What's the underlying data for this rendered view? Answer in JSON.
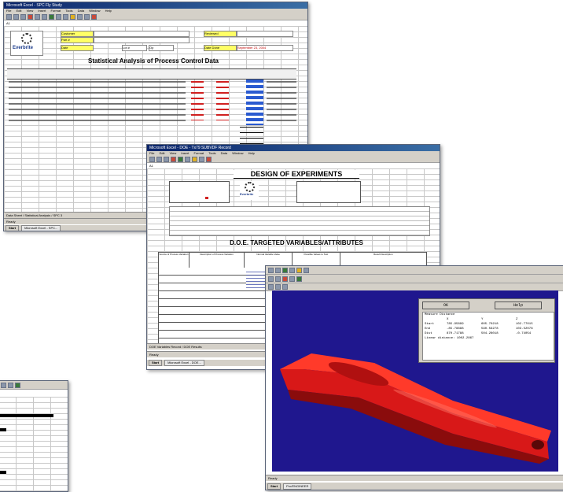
{
  "win1": {
    "title": "Microsoft Excel - SPC Fly Study",
    "menu": [
      "File",
      "Edit",
      "View",
      "Insert",
      "Format",
      "Tools",
      "Data",
      "Window",
      "Help"
    ],
    "cell_ref": "A1",
    "company": "Everbrite",
    "report_title": "Statistical Analysis of Process Control Data",
    "field_labels": [
      "Customer",
      "Part #",
      "Date",
      "Lot #",
      "Op",
      "Reviewed",
      "Date Done"
    ],
    "date_value": "September 23, 2004",
    "sheet_tabs": "Data Sheet / Statistical Analysis / SPC 3",
    "status": "Ready",
    "taskbar_start": "Start",
    "taskbar_item": "Microsoft Excel - SPC..."
  },
  "win2": {
    "title": "Microsoft Excel - DOE - Tx79 SUBVDF Record",
    "menu": [
      "File",
      "Edit",
      "View",
      "Insert",
      "Format",
      "Tools",
      "Data",
      "Window",
      "Help"
    ],
    "cell_ref": "A1",
    "heading": "DESIGN OF EXPERIMENTS",
    "subheading": "D.O.E. TARGETED VARIABLES/ATTRIBUTES",
    "company": "Everbrite",
    "col_headers": [
      "Source of Process Variation",
      "Description of Process Variation",
      "Normal Variable Value",
      "Possible Values to Test",
      "Result Description"
    ],
    "sheet_tabs": "DOE Variables Record / DOE Results",
    "status": "Ready",
    "taskbar_start": "Start",
    "taskbar_item": "Microsoft Excel - DOE..."
  },
  "win3": {
    "dialog": {
      "ok": "OK",
      "help": "Help",
      "heading": "Measure Distance",
      "col_x": "X",
      "col_y": "Y",
      "col_z": "Z",
      "rows": [
        [
          "Start",
          "785.95899",
          "605.70218",
          "102.77015"
        ],
        [
          "End",
          "-85.78888",
          "590.56278",
          "103.52078"
        ],
        [
          "Dist",
          "870.71788",
          "504.28018",
          "-0.74054"
        ]
      ],
      "linear": "Linear distance: 1002.2867"
    },
    "status": "Ready",
    "taskbar_start": "Start",
    "taskbar_item": "Pro/ENGINEER"
  },
  "colors": {
    "excel_title": "#0a246a",
    "viewport_bg": "#1f178e",
    "part_red": "#e01818",
    "highlight_yellow": "#ffff66"
  }
}
